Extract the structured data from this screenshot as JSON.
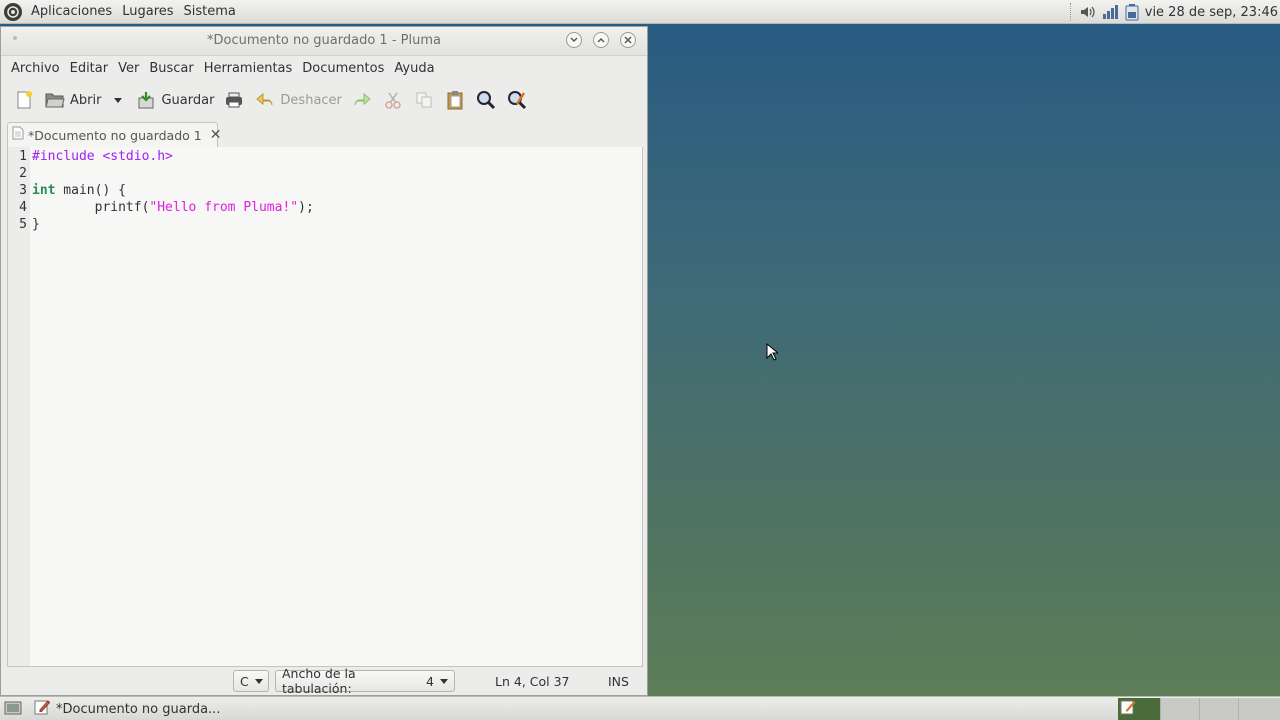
{
  "top_panel": {
    "menus": [
      "Aplicaciones",
      "Lugares",
      "Sistema"
    ],
    "clock": "vie 28 de sep, 23:46",
    "tray_icons": [
      "volume-icon",
      "network-signal-icon",
      "battery-icon"
    ]
  },
  "window": {
    "title": "*Documento no guardado 1 - Pluma",
    "menu": [
      "Archivo",
      "Editar",
      "Ver",
      "Buscar",
      "Herramientas",
      "Documentos",
      "Ayuda"
    ],
    "toolbar": {
      "open_label": "Abrir",
      "save_label": "Guardar",
      "undo_label": "Deshacer"
    },
    "tab_label": "*Documento no guardado 1",
    "code_lines": [
      {
        "num": "1",
        "text": "#include <stdio.h>"
      },
      {
        "num": "2",
        "text": ""
      },
      {
        "num": "3",
        "text": "int main() {"
      },
      {
        "num": "4",
        "text": "        printf(\"Hello from Pluma!\");"
      },
      {
        "num": "5",
        "text": "}"
      }
    ],
    "code_parts": {
      "include": "#include <stdio.h>",
      "int_kw": "int",
      "main_rest": " main() {",
      "printf_pre": "        printf(",
      "printf_str": "\"Hello from Pluma!\"",
      "printf_post": ");",
      "close_brace": "}"
    },
    "status": {
      "language": "C",
      "tab_width_label": "Ancho de la tabulación:",
      "tab_width_value": "4",
      "position": "Ln 4, Col 37",
      "mode": "INS"
    }
  },
  "bottom_panel": {
    "task_label": "*Documento no guarda..."
  },
  "colors": {
    "preprocessor": "#a020f0",
    "string": "#e020e0",
    "keyword": "#2e8b57"
  }
}
